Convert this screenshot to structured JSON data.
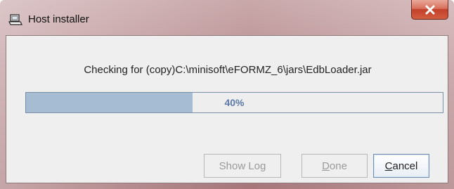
{
  "window": {
    "title": "Host installer",
    "icon": "installer-icon",
    "close_icon": "close-icon"
  },
  "message": "Checking for (copy)C:\\minisoft\\eFORMZ_6\\jars\\EdbLoader.jar",
  "progress": {
    "value": 40,
    "label": "40%"
  },
  "buttons": {
    "show_log": {
      "label": "Show Log",
      "enabled": false
    },
    "done": {
      "mnemonic": "D",
      "rest": "one",
      "enabled": false
    },
    "cancel": {
      "mnemonic": "C",
      "rest": "ancel",
      "enabled": true
    }
  },
  "colors": {
    "progress_fill": "#a6bcd2",
    "progress_text": "#5b79a8",
    "close_button": "#c2402a"
  }
}
